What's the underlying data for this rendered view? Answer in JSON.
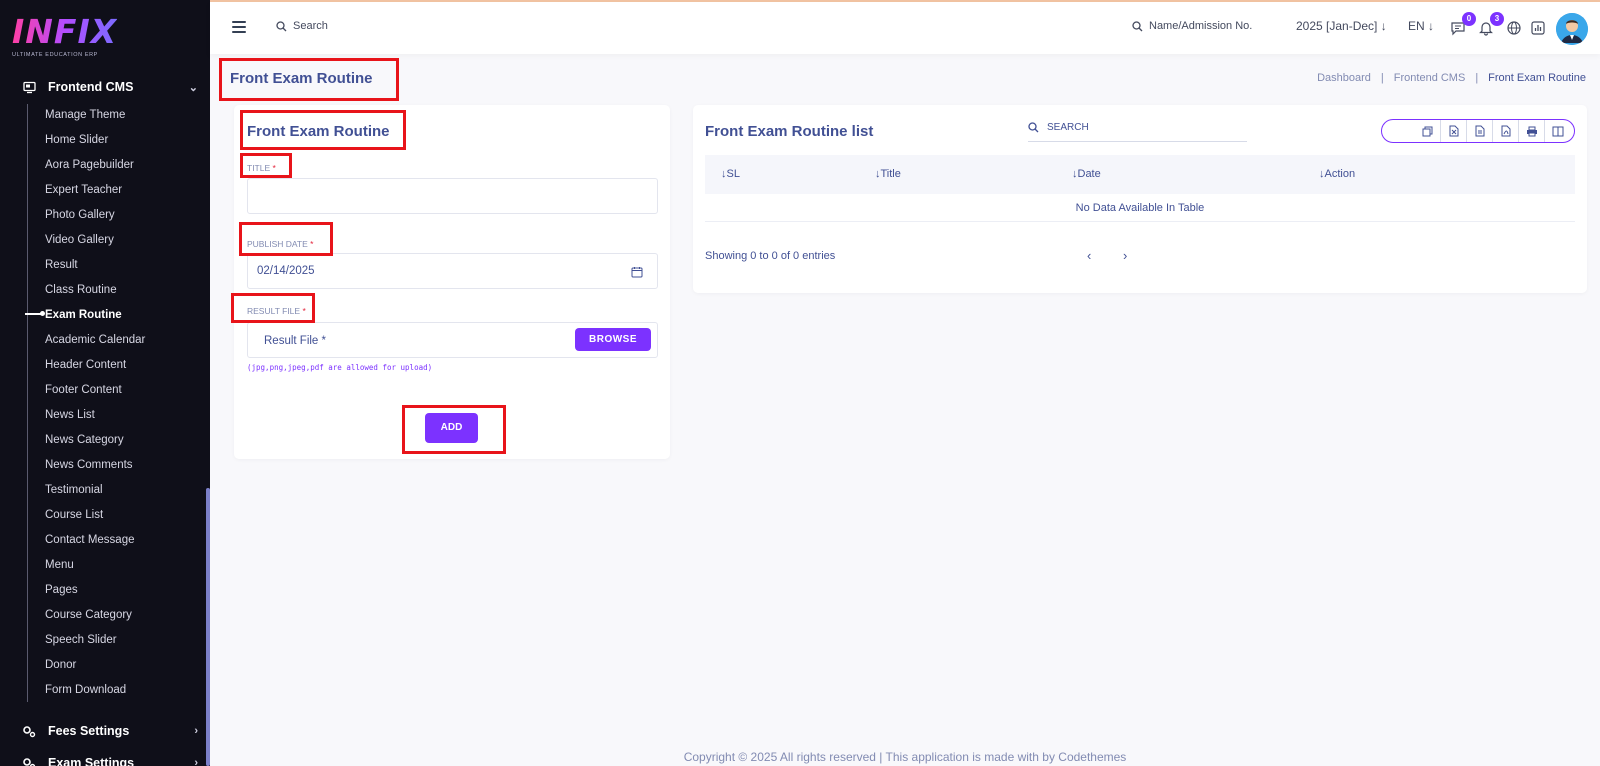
{
  "sidebar": {
    "logo_text": "INFIX",
    "logo_subtitle": "ULTIMATE EDUCATION ERP",
    "section_frontend": "Frontend CMS",
    "items": [
      {
        "label": "Manage Theme"
      },
      {
        "label": "Home Slider"
      },
      {
        "label": "Aora Pagebuilder"
      },
      {
        "label": "Expert Teacher"
      },
      {
        "label": "Photo Gallery"
      },
      {
        "label": "Video Gallery"
      },
      {
        "label": "Result"
      },
      {
        "label": "Class Routine"
      },
      {
        "label": "Exam Routine",
        "active": true
      },
      {
        "label": "Academic Calendar"
      },
      {
        "label": "Header Content"
      },
      {
        "label": "Footer Content"
      },
      {
        "label": "News List"
      },
      {
        "label": "News Category"
      },
      {
        "label": "News Comments"
      },
      {
        "label": "Testimonial"
      },
      {
        "label": "Course List"
      },
      {
        "label": "Contact Message"
      },
      {
        "label": "Menu"
      },
      {
        "label": "Pages"
      },
      {
        "label": "Course Category"
      },
      {
        "label": "Speech Slider"
      },
      {
        "label": "Donor"
      },
      {
        "label": "Form Download"
      }
    ],
    "section_fees": "Fees Settings",
    "section_exam": "Exam Settings"
  },
  "topbar": {
    "search_placeholder": "Search",
    "admission_search": "Name/Admission No.",
    "session": "2025 [Jan-Dec]",
    "language": "EN",
    "chat_count": "0",
    "notification_count": "3",
    "icons": [
      "menu-icon",
      "search-icon",
      "chat-icon",
      "bell-icon",
      "globe-icon",
      "chart-icon"
    ]
  },
  "page": {
    "title": "Front Exam Routine",
    "breadcrumb": [
      "Dashboard",
      "Frontend CMS",
      "Front Exam Routine"
    ]
  },
  "form": {
    "title": "Front Exam Routine",
    "title_label": "TITLE",
    "title_value": "",
    "publish_date_label": "PUBLISH DATE",
    "publish_date_value": "02/14/2025",
    "result_file_label": "RESULT FILE",
    "result_file_placeholder": "Result File *",
    "browse_label": "BROWSE",
    "file_hint": "(jpg,png,jpeg,pdf are allowed for upload)",
    "add_label": "ADD",
    "required_mark": "*"
  },
  "list": {
    "title": "Front Exam Routine list",
    "search_placeholder": "SEARCH",
    "columns": [
      "SL",
      "Title",
      "Date",
      "Action"
    ],
    "empty_text": "No Data Available In Table",
    "showing_text": "Showing 0 to 0 of 0 entries",
    "export_buttons": [
      "copy-icon",
      "excel-icon",
      "csv-icon",
      "pdf-icon",
      "print-icon",
      "columns-icon"
    ]
  },
  "footer": {
    "text": "Copyright © 2025 All rights reserved | This application is made with by Codethemes"
  },
  "colors": {
    "accent": "#7c32ff",
    "sidebar_bg": "#0f0f19",
    "text_primary": "#415094",
    "annotation_red": "#e8141a"
  }
}
